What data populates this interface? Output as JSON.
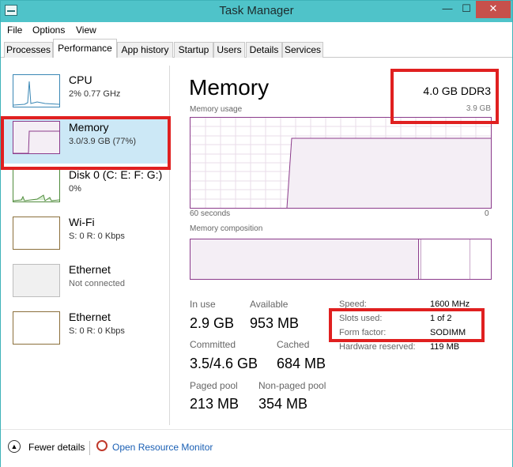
{
  "window": {
    "title": "Task Manager",
    "controls": {
      "minimize": "—",
      "maximize": "☐",
      "close": "✕"
    }
  },
  "menu": [
    "File",
    "Options",
    "View"
  ],
  "tabs": [
    "Processes",
    "Performance",
    "App history",
    "Startup",
    "Users",
    "Details",
    "Services"
  ],
  "active_tab": "Performance",
  "sidebar": {
    "items": [
      {
        "name": "CPU",
        "sub": "2%  0.77 GHz"
      },
      {
        "name": "Memory",
        "sub": "3.0/3.9 GB (77%)"
      },
      {
        "name": "Disk 0 (C: E: F: G:)",
        "sub": "0%"
      },
      {
        "name": "Wi-Fi",
        "sub": "S: 0 R: 0 Kbps"
      },
      {
        "name": "Ethernet",
        "sub": "Not connected"
      },
      {
        "name": "Ethernet",
        "sub": "S: 0 R: 0 Kbps"
      }
    ],
    "selected_index": 1
  },
  "memory": {
    "title": "Memory",
    "spec": "4.0 GB DDR3",
    "total": "3.9 GB",
    "usage_label": "Memory usage",
    "axis_left": "60 seconds",
    "axis_right": "0",
    "composition_label": "Memory composition",
    "stats": {
      "in_use": {
        "label": "In use",
        "value": "2.9 GB"
      },
      "available": {
        "label": "Available",
        "value": "953 MB"
      },
      "committed": {
        "label": "Committed",
        "value": "3.5/4.6 GB"
      },
      "cached": {
        "label": "Cached",
        "value": "684 MB"
      },
      "paged_pool": {
        "label": "Paged pool",
        "value": "213 MB"
      },
      "nonpaged_pool": {
        "label": "Non-paged pool",
        "value": "354 MB"
      }
    },
    "info": {
      "speed": {
        "label": "Speed:",
        "value": "1600 MHz"
      },
      "slots": {
        "label": "Slots used:",
        "value": "1 of 2"
      },
      "form": {
        "label": "Form factor:",
        "value": "SODIMM"
      },
      "reserved": {
        "label": "Hardware reserved:",
        "value": "119 MB"
      }
    }
  },
  "footer": {
    "fewer_details": "Fewer details",
    "resource_monitor": "Open Resource Monitor"
  },
  "colors": {
    "titlebar": "#4fc3c9",
    "memory_line": "#8b3b8b",
    "memory_fill": "#f4eef5",
    "selected": "#cce8f6",
    "highlight_box": "#e02020",
    "link": "#1a5fb4"
  }
}
